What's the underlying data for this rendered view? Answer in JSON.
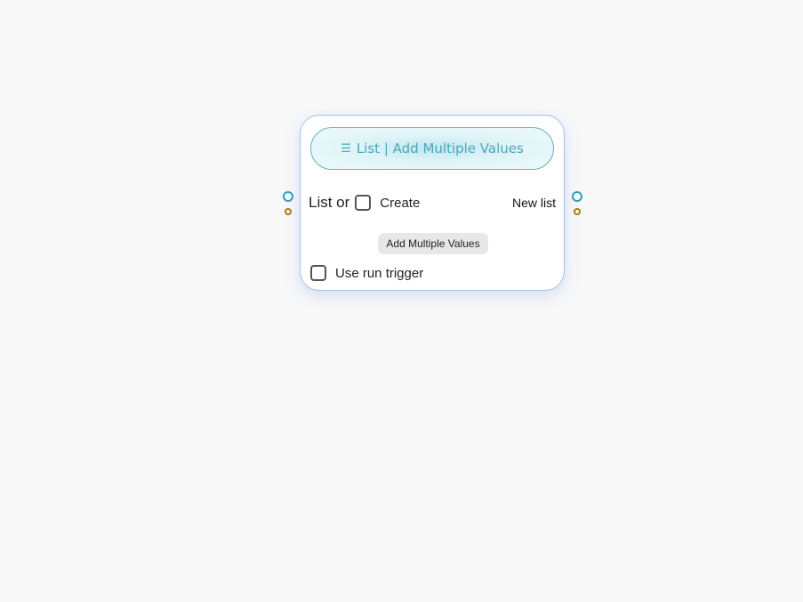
{
  "node": {
    "title": "List | Add Multiple Values",
    "title_icon": "list-icon",
    "list_label": "List or",
    "create_label": "Create",
    "create_checked": false,
    "output_label": "New list",
    "action_label": "Add Multiple Values",
    "run_trigger_label": "Use run trigger",
    "run_trigger_checked": false
  },
  "colors": {
    "title_text": "#4aa8b8",
    "title_border": "#5fb3c2",
    "data_port": "#2f9dbd",
    "trigger_port": "#a67c10",
    "node_border": "#9fc3ea",
    "canvas_bg": "#f8f8f9"
  }
}
